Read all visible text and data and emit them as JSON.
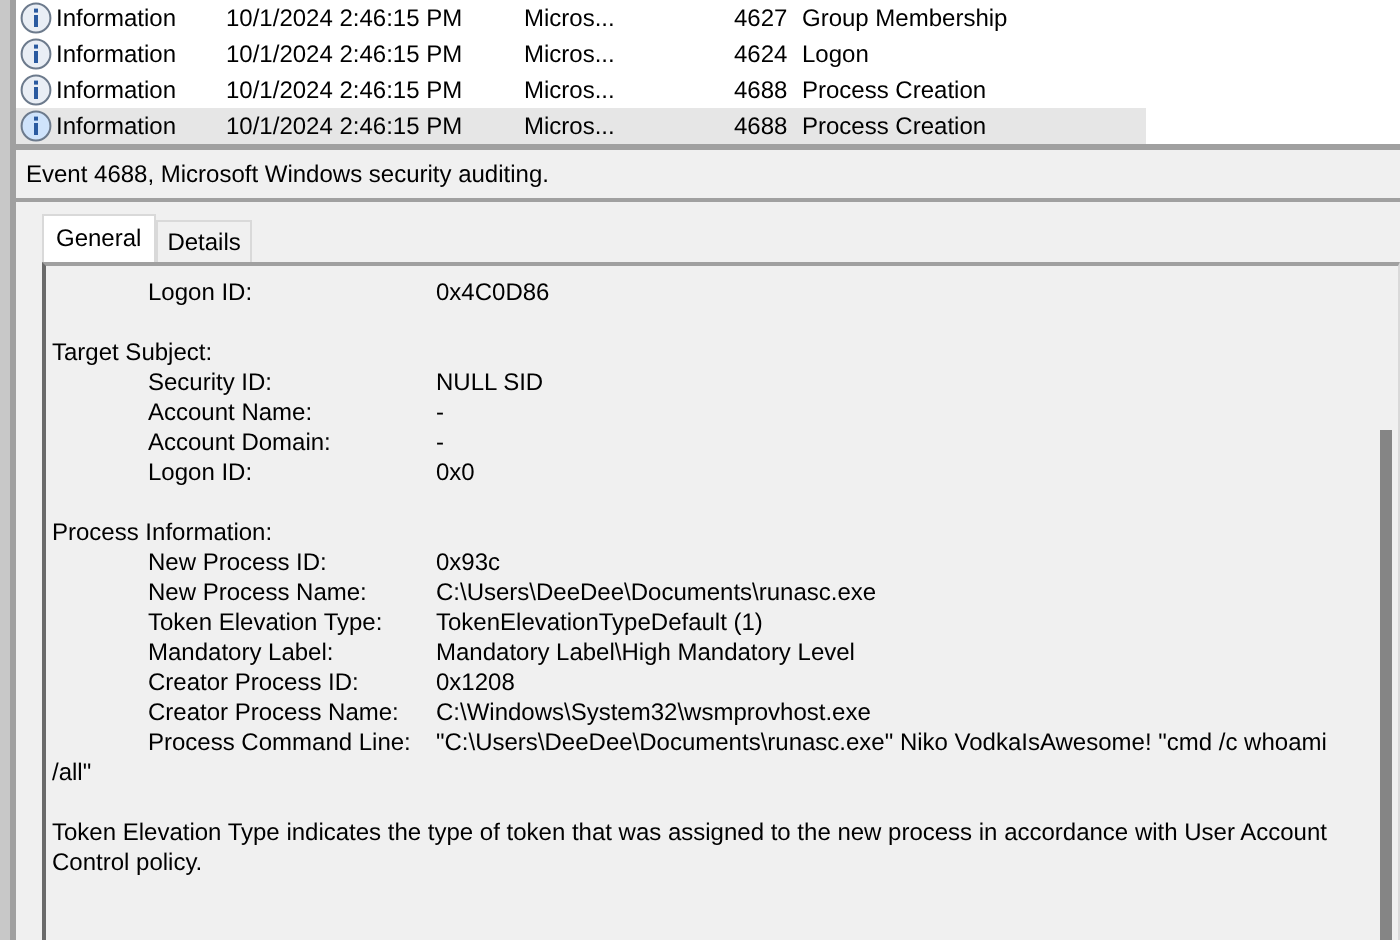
{
  "events": [
    {
      "level": "Information",
      "date": "10/1/2024 2:46:15 PM",
      "source": "Micros...",
      "id": "4627",
      "task": "Group Membership",
      "selected": false
    },
    {
      "level": "Information",
      "date": "10/1/2024 2:46:15 PM",
      "source": "Micros...",
      "id": "4624",
      "task": "Logon",
      "selected": false
    },
    {
      "level": "Information",
      "date": "10/1/2024 2:46:15 PM",
      "source": "Micros...",
      "id": "4688",
      "task": "Process Creation",
      "selected": false
    },
    {
      "level": "Information",
      "date": "10/1/2024 2:46:15 PM",
      "source": "Micros...",
      "id": "4688",
      "task": "Process Creation",
      "selected": true
    }
  ],
  "detail_title": "Event 4688, Microsoft Windows security auditing.",
  "tabs": [
    {
      "label": "General",
      "selected": true
    },
    {
      "label": "Details",
      "selected": false
    }
  ],
  "sections": [
    {
      "fields": [
        {
          "label": "Logon ID:",
          "value": "0x4C0D86"
        }
      ]
    },
    {
      "heading": "Target Subject:",
      "fields": [
        {
          "label": "Security ID:",
          "value": "NULL SID"
        },
        {
          "label": "Account Name:",
          "value": "-"
        },
        {
          "label": "Account Domain:",
          "value": "-"
        },
        {
          "label": "Logon ID:",
          "value": "0x0"
        }
      ]
    },
    {
      "heading": "Process Information:",
      "fields": [
        {
          "label": "New Process ID:",
          "value": "0x93c"
        },
        {
          "label": "New Process Name:",
          "value": "C:\\Users\\DeeDee\\Documents\\runasc.exe"
        },
        {
          "label": "Token Elevation Type:",
          "value": "TokenElevationTypeDefault (1)"
        },
        {
          "label": "Mandatory Label:",
          "value": "Mandatory Label\\High Mandatory Level"
        },
        {
          "label": "Creator Process ID:",
          "value": "0x1208"
        },
        {
          "label": "Creator Process Name:",
          "value": "C:\\Windows\\System32\\wsmprovhost.exe"
        },
        {
          "label": "Process Command Line:",
          "value": "\"C:\\Users\\DeeDee\\Documents\\runasc.exe\" Niko VodkaIsAwesome! \"cmd /c whoami /all\""
        }
      ]
    }
  ],
  "paragraphs": [
    "Token Elevation Type indicates the type of token that was assigned to the new process in accordance with User Account Control policy."
  ]
}
